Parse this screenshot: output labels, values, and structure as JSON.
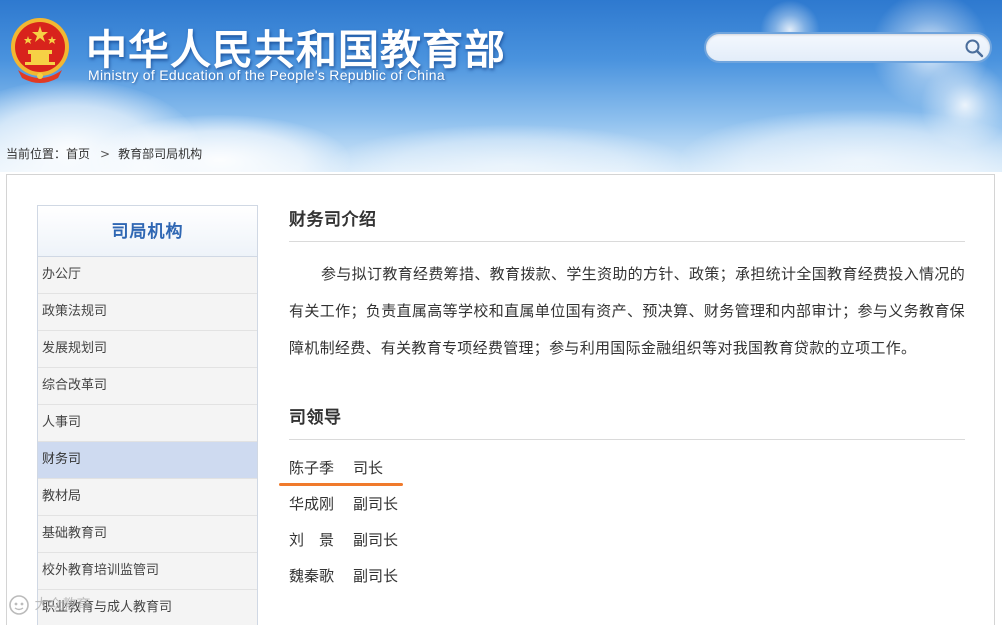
{
  "header": {
    "title": "中华人民共和国教育部",
    "subtitle": "Ministry of Education of the People's Republic of China",
    "emblem_icon": "national-emblem-icon"
  },
  "search": {
    "placeholder": "",
    "icon": "search-icon"
  },
  "breadcrumb": {
    "prefix": "当前位置：",
    "home": "首页",
    "separator": ">",
    "current": "教育部司局机构"
  },
  "sidebar": {
    "title": "司局机构",
    "items": [
      {
        "label": "办公厅"
      },
      {
        "label": "政策法规司"
      },
      {
        "label": "发展规划司"
      },
      {
        "label": "综合改革司"
      },
      {
        "label": "人事司"
      },
      {
        "label": "财务司",
        "active": true
      },
      {
        "label": "教材局"
      },
      {
        "label": "基础教育司"
      },
      {
        "label": "校外教育培训监管司"
      },
      {
        "label": "职业教育与成人教育司"
      }
    ]
  },
  "content": {
    "intro_title": "财务司介绍",
    "intro_text": "参与拟订教育经费筹措、教育拨款、学生资助的方针、政策；承担统计全国教育经费投入情况的有关工作；负责直属高等学校和直属单位国有资产、预决算、财务管理和内部审计；参与义务教育保障机制经费、有关教育专项经费管理；参与利用国际金融组织等对我国教育贷款的立项工作。",
    "leaders_title": "司领导",
    "leaders": [
      {
        "name": "陈子季",
        "role": "司长"
      },
      {
        "name": "华成刚",
        "role": "副司长"
      },
      {
        "name": "刘　景",
        "role": "副司长"
      },
      {
        "name": "魏秦歌",
        "role": "副司长"
      }
    ]
  },
  "watermark": {
    "text": "大众教育"
  },
  "colors": {
    "header_blue": "#2e79cf",
    "sidebar_title": "#2f67b3",
    "active_item_bg": "#cedaf0",
    "annotation_orange": "#f07a2c"
  }
}
